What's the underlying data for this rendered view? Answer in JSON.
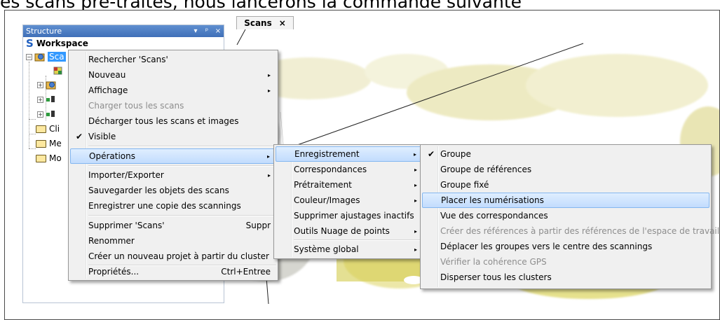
{
  "document_text": "es scans pré-traités, nous lancerons la commande suivante",
  "panel": {
    "title": "Structure",
    "header_buttons": [
      "▾",
      "ᵖ",
      "×"
    ],
    "tree": {
      "workspace": "Workspace",
      "scans_label": "Sca",
      "items": [
        "Cli",
        "Me",
        "Mo"
      ]
    }
  },
  "tab": {
    "label": "Scans",
    "close": "×"
  },
  "context_menu": {
    "items": [
      {
        "label": "Rechercher 'Scans'"
      },
      {
        "label": "Nouveau",
        "arrow": "▸"
      },
      {
        "label": "Affichage",
        "arrow": "▸"
      },
      {
        "label": "Charger tous les scans",
        "disabled": true
      },
      {
        "label": "Décharger tous les scans et images"
      },
      {
        "label": "Visible",
        "check": "✔"
      },
      {
        "label": "Opérations",
        "arrow": "▸"
      },
      {
        "label": "Importer/Exporter",
        "arrow": "▸"
      },
      {
        "label": "Sauvegarder les objets des scans"
      },
      {
        "label": "Enregistrer une copie des scannings"
      },
      {
        "label": "Supprimer 'Scans'",
        "shortcut": "Suppr"
      },
      {
        "label": "Renommer"
      },
      {
        "label": "Créer un nouveau projet à partir du cluster"
      },
      {
        "label": "Propriétés...",
        "shortcut": "Ctrl+Entree"
      }
    ]
  },
  "operations_menu": {
    "items": [
      {
        "label": "Enregistrement",
        "arrow": "▸"
      },
      {
        "label": "Correspondances",
        "arrow": "▸"
      },
      {
        "label": "Prétraitement",
        "arrow": "▸"
      },
      {
        "label": "Couleur/Images",
        "arrow": "▸"
      },
      {
        "label": "Supprimer ajustages inactifs"
      },
      {
        "label": "Outils Nuage de points",
        "arrow": "▸"
      },
      {
        "label": "Système global",
        "arrow": "▸"
      }
    ]
  },
  "registration_menu": {
    "items": [
      {
        "label": "Groupe",
        "check": "✔"
      },
      {
        "label": "Groupe de références"
      },
      {
        "label": "Groupe fixé"
      },
      {
        "label": "Placer les numérisations"
      },
      {
        "label": "Vue des correspondances"
      },
      {
        "label": "Créer des références à partir des références de l'espace de travail",
        "disabled": true
      },
      {
        "label": "Déplacer les groupes vers le centre des scannings"
      },
      {
        "label": "Vérifier la cohérence GPS",
        "disabled": true
      },
      {
        "label": "Disperser tous les clusters"
      }
    ]
  },
  "colors": {
    "highlight": "#3399ff",
    "menu_bg": "#f0f0f0",
    "panel_header": "#4f7fc4",
    "point_cloud": "#d9d36a"
  }
}
